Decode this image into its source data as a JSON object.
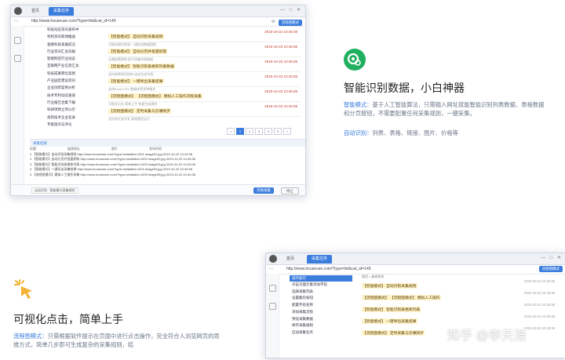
{
  "app": {
    "tab_home": "首页",
    "tab_task": "采集任务",
    "url": "http://www.houseuse.com/?type=list&cat_id=149",
    "btn_flow": "流程图模式",
    "btn_collect": "开始采集",
    "btn_stop": "停止"
  },
  "shot1": {
    "sidebar": [
      "科技动态资讯发布中",
      "机构资讯新闻推送",
      "金融科技发展前沿",
      "行业资讯汇总日报",
      "智能制造行业动态",
      "互联网产业信息汇总",
      "科技成果转化案例",
      "产业园区建设资讯",
      "企业创新案例分析",
      "技术专利动态速递",
      "行业报告合集下载",
      "科研项目立项公示",
      "高新技术企业名录",
      "专家观点与评论"
    ],
    "items": [
      {
        "title": "【智能模式】 自动识别采集规则",
        "sub": "可视化操作界面 一键完成数据提取",
        "date": "2019-10-22 10:40:38"
      },
      {
        "title": "【智能模式】 自动分页并批量抓取",
        "sub": "无需配置规则 即可采集列表数据",
        "date": "2019-10-22 10:40:38"
      },
      {
        "title": "【智能模式】 智能识别表格和列表数据",
        "sub": "支持多种网页结构 自动生成字段",
        "date": "2019-10-22 10:40:38"
      },
      {
        "title": "【智能模式】 一键导出采集结果",
        "sub": "支持Excel CSV 数据库等多种格式",
        "date": "2019-10-22 10:40:38"
      },
      {
        "title": "【流程图模式】 【流程图模式】 模拟人工操作流程采集",
        "sub": "可视化点击 简单上手 快速生成规则",
        "date": "2019-10-22 10:40:38"
      },
      {
        "title": "【流程图模式】 定时采集与云端同步",
        "sub": "支持多任务并发 高效稳定运行",
        "date": "2019-10-22 10:40:38"
      }
    ],
    "pages": [
      "<",
      "1",
      "2",
      "3",
      "4",
      "5",
      ">"
    ],
    "bottom_label": "采集结果",
    "table_header": [
      "标题",
      "链接地址",
      "图片",
      "发布时间"
    ],
    "rows": [
      [
        "1 【智能模式】自动识别采集规则",
        "http://www.houseuse.com/?type=detail&id=1001",
        "image01.jpg",
        "2019-10-22 10:40:38"
      ],
      [
        "2 【智能模式】自动分页并批量抓取",
        "http://www.houseuse.com/?type=detail&id=1002",
        "image02.jpg",
        "2019-10-22 10:40:38"
      ],
      [
        "3 【智能模式】智能识别表格和列表",
        "http://www.houseuse.com/?type=detail&id=1003",
        "image03.jpg",
        "2019-10-22 10:40:38"
      ],
      [
        "4 【智能模式】一键导出采集结果",
        "http://www.houseuse.com/?type=detail&id=1004",
        "image04.jpg",
        "2019-10-22 10:40:38"
      ],
      [
        "5 【流程图模式】模拟人工操作采集",
        "http://www.houseuse.com/?type=detail&id=1005",
        "image05.jpg",
        "2019-10-22 10:40:38"
      ]
    ],
    "footer_tab": "自动识别 · 智能模式采集规则"
  },
  "feature_ai": {
    "title": "智能识别数据，小白神器",
    "line1_label": "智能模式：",
    "line1": "基于人工智能算法，只需输入网址就能智能识别列表数据、表格数据和分页按钮，不需要配置任何采集规则，一键采集。",
    "line2_label": "自动识别：",
    "line2": "列表、表格、链接、图片、价格等"
  },
  "feature_vis": {
    "title": "可视化点击，简单上手",
    "line1_label": "流程图模式：",
    "line1": "只需根据软件提示在页面中进行点击操作，完全符合人浏览网页的思维方式，简单几步即可生成复杂的采集规则，结"
  },
  "shot2": {
    "breadcrumb": "首页 > 新闻资讯",
    "sidebar_head": "操作提示",
    "sidebar": [
      "点击页面元素添加字段",
      "选择采集列表",
      "设置翻页按钮",
      "配置字段名称",
      "添加采集流程",
      "预览采集数据",
      "保存采集规则",
      "启动采集任务"
    ],
    "items": [
      {
        "title": "【智能模式】 自动识别采集规则",
        "date": "2019-10-22 10:40:38"
      },
      {
        "title": "【流程图模式】 【流程图模式】 模拟人工操作",
        "date": "2019-10-22 10:40:38"
      },
      {
        "title": "【智能模式】 智能识别表格和列表",
        "date": "2019-10-22 10:40:38"
      },
      {
        "title": "【智能模式】 一键导出采集结果",
        "date": "2019-10-22 10:40:38"
      },
      {
        "title": "【流程图模式】 定时采集与云端同步",
        "date": "2019-10-22 10:40:38"
      }
    ]
  },
  "watermark": "知乎 @李天浩"
}
